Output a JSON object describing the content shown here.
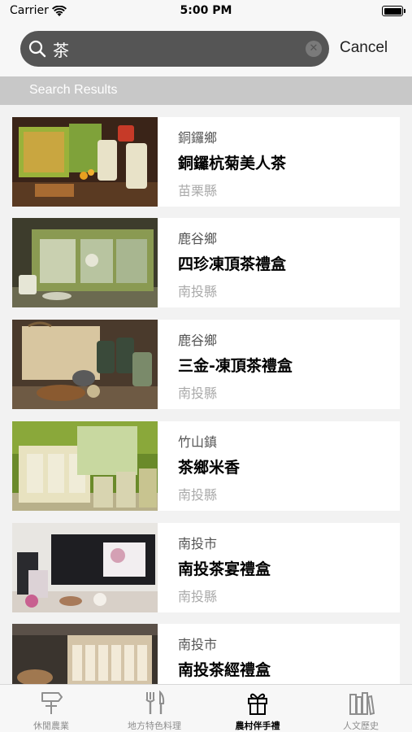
{
  "status_bar": {
    "carrier": "Carrier",
    "time": "5:00 PM"
  },
  "search": {
    "value": "茶",
    "cancel_label": "Cancel"
  },
  "section_header": "Search Results",
  "results": [
    {
      "town": "銅鑼鄉",
      "name": "銅鑼杭菊美人茶",
      "county": "苗栗縣"
    },
    {
      "town": "鹿谷鄉",
      "name": "四珍凍頂茶禮盒",
      "county": "南投縣"
    },
    {
      "town": "鹿谷鄉",
      "name": "三金-凍頂茶禮盒",
      "county": "南投縣"
    },
    {
      "town": "竹山鎮",
      "name": "茶鄉米香",
      "county": "南投縣"
    },
    {
      "town": "南投市",
      "name": "南投茶宴禮盒",
      "county": "南投縣"
    },
    {
      "town": "南投市",
      "name": "南投茶經禮盒",
      "county": ""
    }
  ],
  "tabs": [
    {
      "label": "休閒農業",
      "icon": "signpost-icon",
      "active": false
    },
    {
      "label": "地方特色料理",
      "icon": "fork-knife-icon",
      "active": false
    },
    {
      "label": "農村伴手禮",
      "icon": "gift-icon",
      "active": true
    },
    {
      "label": "人文歷史",
      "icon": "books-icon",
      "active": false
    }
  ]
}
